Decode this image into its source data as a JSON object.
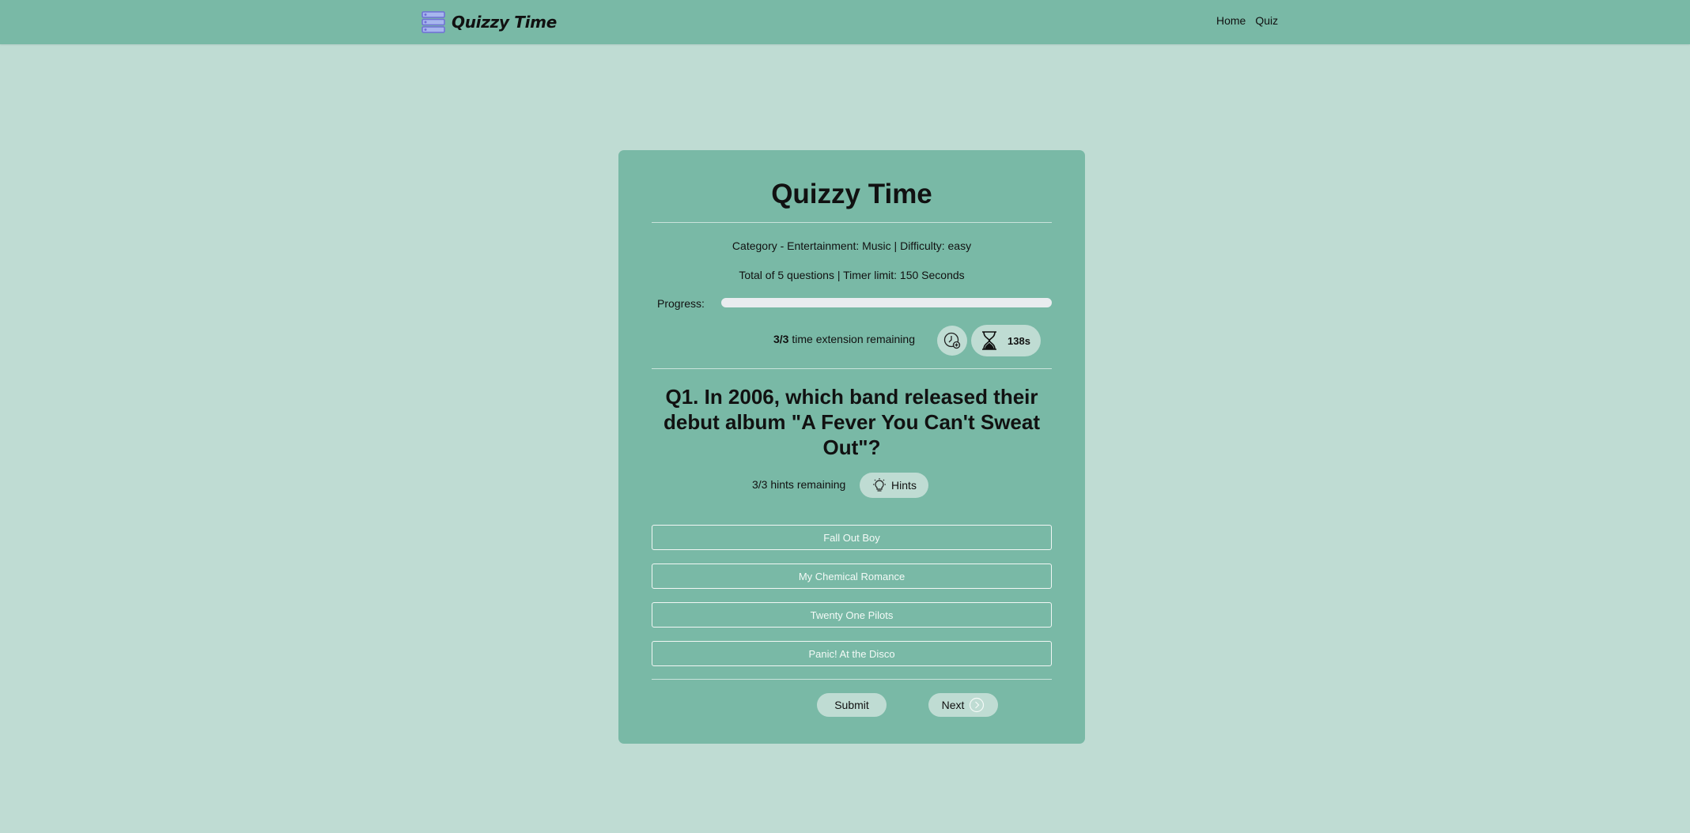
{
  "navbar": {
    "brand": "Quizzy Time",
    "links": [
      "Home",
      "Quiz"
    ]
  },
  "quiz": {
    "title": "Quizzy Time",
    "category_line": "Category - Entertainment: Music | Difficulty: easy",
    "total_line": "Total of 5 questions | Timer limit: 150 Seconds",
    "progress_label": "Progress:",
    "progress_fraction": 0,
    "extensions_remaining": "3/3",
    "extensions_text": "time extension remaining",
    "timer_value": "138s",
    "question": "Q1. In 2006, which band released their debut album \"A Fever You Can't Sweat Out\"?",
    "hints_remaining_text": "3/3 hints remaining",
    "hints_button": "Hints",
    "answers": [
      "Fall Out Boy",
      "My Chemical Romance",
      "Twenty One Pilots",
      "Panic! At the Disco"
    ],
    "submit_label": "Submit",
    "next_label": "Next"
  },
  "icons": {
    "brand": "list-icon",
    "extension": "clock-plus-icon",
    "timer": "hourglass-icon",
    "hints": "lightbulb-icon",
    "next": "chevron-right-circle-icon"
  },
  "colors": {
    "background": "#bfdcd3",
    "primary": "#79b9a6",
    "brand_icon": "#6f6fd6"
  }
}
